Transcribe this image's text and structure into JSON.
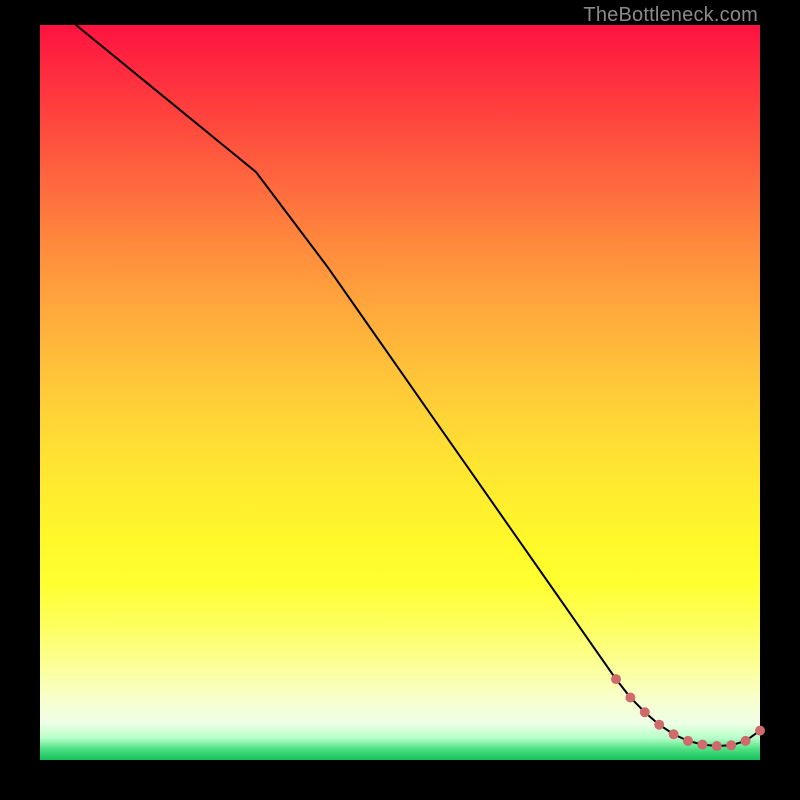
{
  "watermark": "TheBottleneck.com",
  "colors": {
    "curve": "#000000",
    "marker_fill": "#cf6a6d",
    "marker_stroke": "#cf6a6d"
  },
  "chart_data": {
    "type": "line",
    "title": "",
    "xlabel": "",
    "ylabel": "",
    "xlim": [
      0,
      100
    ],
    "ylim": [
      0,
      100
    ],
    "grid": false,
    "series": [
      {
        "name": "curve",
        "x": [
          5,
          10,
          15,
          20,
          25,
          30,
          35,
          40,
          45,
          50,
          55,
          60,
          65,
          70,
          75,
          80,
          82,
          84,
          86,
          88,
          90,
          92,
          94,
          96,
          98,
          100
        ],
        "y": [
          100,
          96,
          92,
          88,
          84,
          80,
          73.5,
          67,
          60,
          53,
          46,
          39,
          32,
          25,
          18,
          11,
          8.5,
          6.5,
          4.8,
          3.5,
          2.6,
          2.1,
          1.9,
          2.0,
          2.6,
          4.0
        ]
      },
      {
        "name": "markers",
        "x": [
          80,
          82,
          84,
          86,
          88,
          90,
          92,
          94,
          96,
          98,
          100
        ],
        "y": [
          11,
          8.5,
          6.5,
          4.8,
          3.5,
          2.6,
          2.1,
          1.9,
          2.0,
          2.6,
          4.0
        ]
      }
    ]
  }
}
